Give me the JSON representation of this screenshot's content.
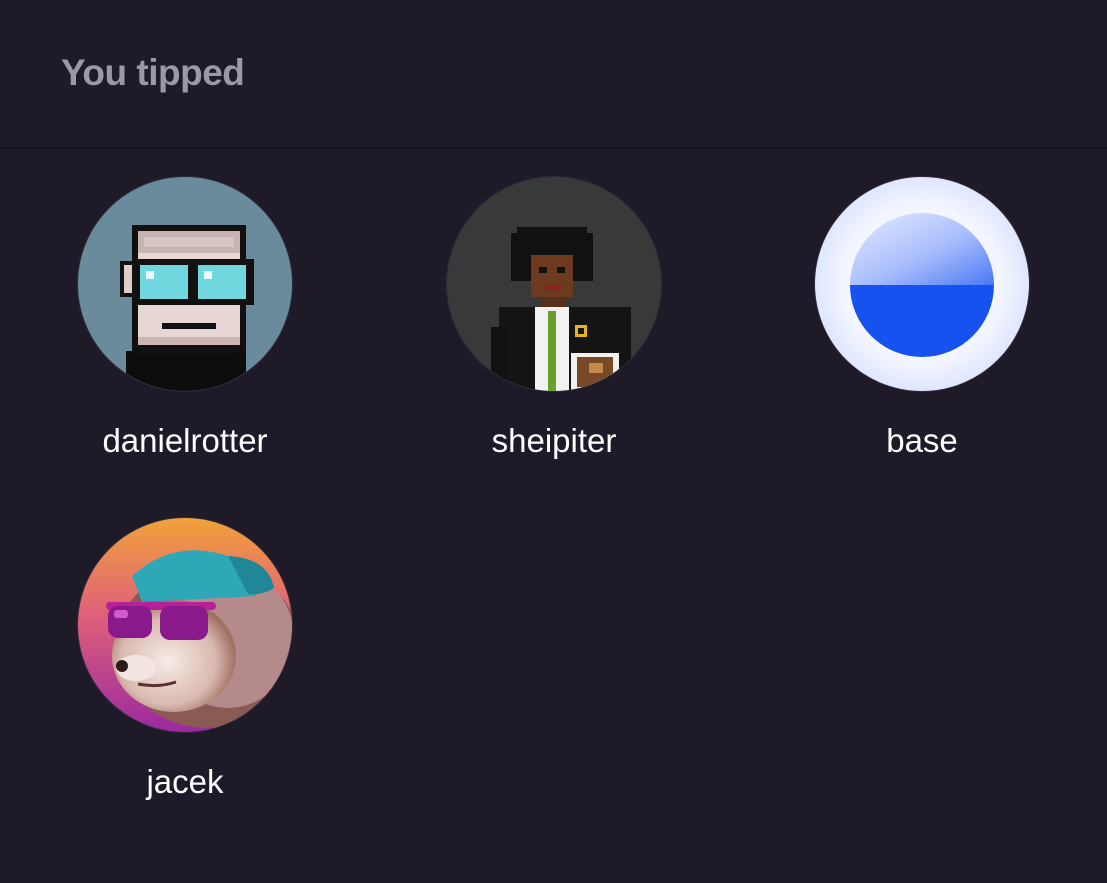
{
  "header": {
    "title": "You tipped"
  },
  "users": [
    {
      "username": "danielrotter",
      "avatar_icon": "pixel-glasses-avatar-icon"
    },
    {
      "username": "sheipiter",
      "avatar_icon": "pixel-suit-avatar-icon"
    },
    {
      "username": "base",
      "avatar_icon": "base-logo-icon"
    },
    {
      "username": "jacek",
      "avatar_icon": "hedgehog-avatar-icon"
    }
  ],
  "colors": {
    "background": "#1f1a28",
    "title": "#9c98a8",
    "username": "#ffffff",
    "base_blue": "#1652f0"
  }
}
